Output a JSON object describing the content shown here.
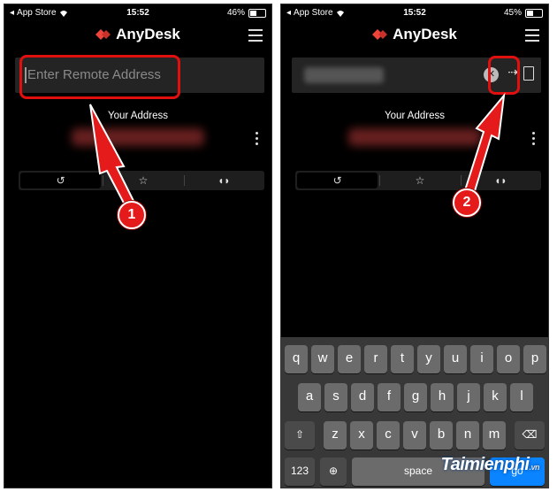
{
  "left_phone": {
    "status": {
      "carrier": "App Store",
      "time": "15:52",
      "battery": "46%",
      "battery_level": 0.46
    },
    "app_name": "AnyDesk",
    "address_placeholder": "Enter Remote Address",
    "your_address_label": "Your Address",
    "tabs": [
      "history-icon",
      "star-icon",
      "discover-icon"
    ],
    "step_badge": "1"
  },
  "right_phone": {
    "status": {
      "carrier": "App Store",
      "time": "15:52",
      "battery": "45%",
      "battery_level": 0.45
    },
    "app_name": "AnyDesk",
    "your_address_label": "Your Address",
    "go_arrow": "⇢",
    "tabs": [
      "history-icon",
      "star-icon",
      "discover-icon"
    ],
    "step_badge": "2",
    "keyboard": {
      "row1": [
        "q",
        "w",
        "e",
        "r",
        "t",
        "y",
        "u",
        "i",
        "o",
        "p"
      ],
      "row2": [
        "a",
        "s",
        "d",
        "f",
        "g",
        "h",
        "j",
        "k",
        "l"
      ],
      "row3": [
        "z",
        "x",
        "c",
        "v",
        "b",
        "n",
        "m"
      ],
      "numbers_key": "123",
      "space_key": "space",
      "go_key": "go"
    }
  },
  "watermark": {
    "text": "Taimienphi",
    "suffix": ".vn"
  },
  "colors": {
    "annotation_red": "#e20f0f",
    "anydesk_red": "#ef443b",
    "background": "#000000"
  }
}
